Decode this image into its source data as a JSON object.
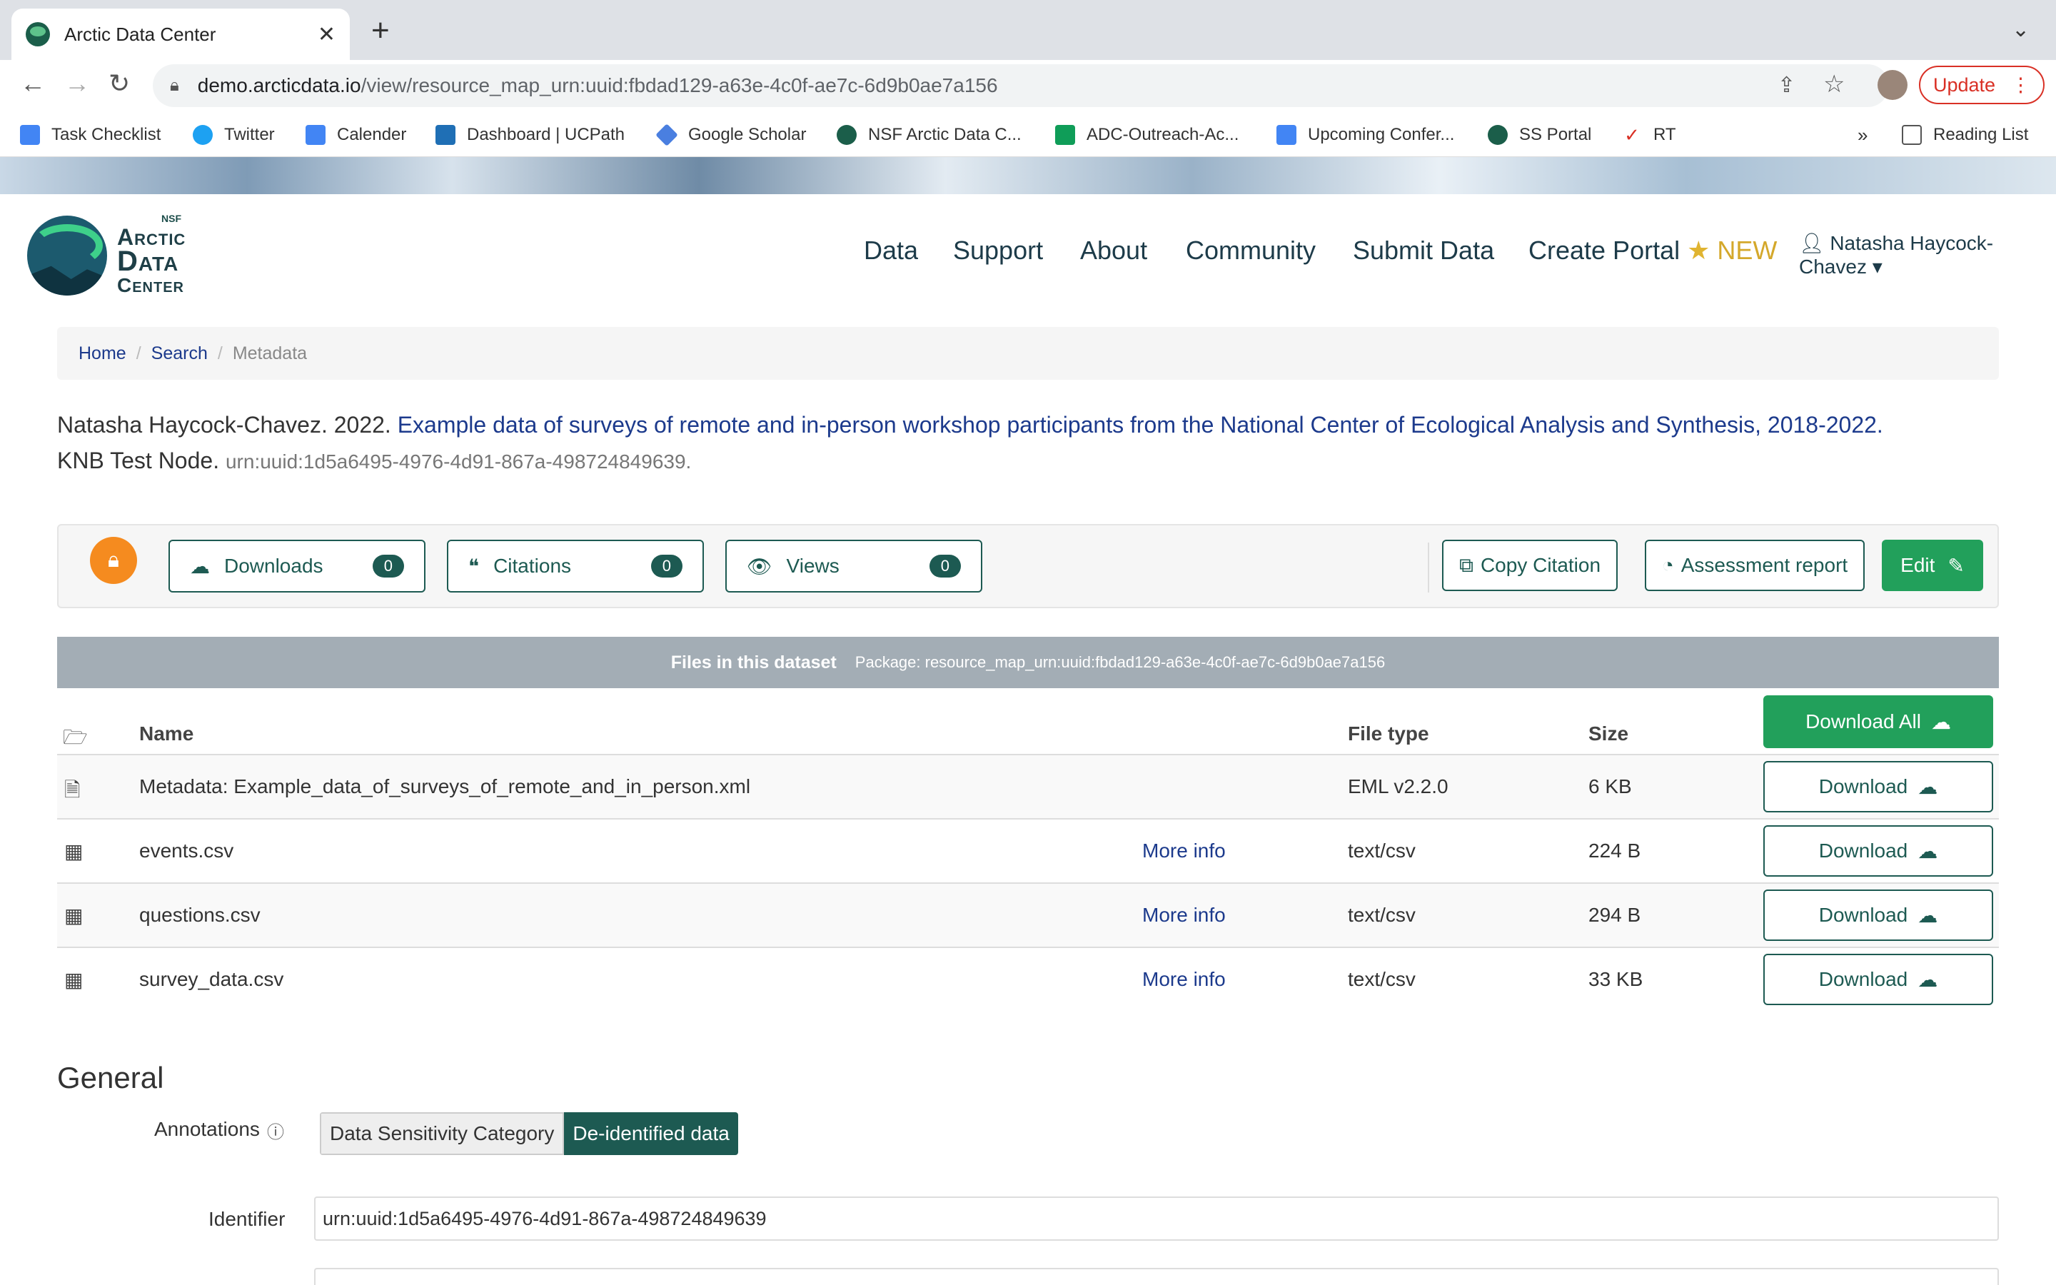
{
  "browser": {
    "tab_title": "Arctic Data Center",
    "url_host": "demo.arcticdata.io",
    "url_path": "/view/resource_map_urn:uuid:fbdad129-a63e-4c0f-ae7c-6d9b0ae7a156",
    "update_label": "Update",
    "bookmarks": [
      {
        "label": "Task Checklist",
        "color": "#4285f4"
      },
      {
        "label": "Twitter",
        "color": "#1da1f2"
      },
      {
        "label": "Calender",
        "color": "#4285f4"
      },
      {
        "label": "Dashboard | UCPath",
        "color": "#1f6fb5"
      },
      {
        "label": "Google Scholar",
        "color": "#4a7fe0"
      },
      {
        "label": "NSF Arctic Data C...",
        "color": "#1b5e4a"
      },
      {
        "label": "ADC-Outreach-Ac...",
        "color": "#0f9d58"
      },
      {
        "label": "Upcoming Confer...",
        "color": "#4285f4"
      },
      {
        "label": "SS Portal",
        "color": "#1b5e4a"
      },
      {
        "label": "RT",
        "color": "#d93025"
      }
    ],
    "overflow_label": "»",
    "reading_list": "Reading List"
  },
  "site": {
    "logo": {
      "nsf": "NSF",
      "line1": "Arctic",
      "line2": "Data",
      "line3": "Center"
    },
    "nav": [
      "Data",
      "Support",
      "About",
      "Community",
      "Submit Data",
      "Create Portal"
    ],
    "nav_new": "NEW",
    "user": "Natasha Haycock-Chavez"
  },
  "breadcrumb": {
    "home": "Home",
    "search": "Search",
    "current": "Metadata"
  },
  "citation": {
    "authors": "Natasha Haycock-Chavez. 2022. ",
    "title": "Example data of surveys of remote and in-person workshop participants from the National Center of Ecological Analysis and Synthesis, 2018-2022.",
    "repo": "KNB Test Node. ",
    "id": "urn:uuid:1d5a6495-4976-4d91-867a-498724849639."
  },
  "metrics": {
    "downloads": {
      "label": "Downloads",
      "count": "0"
    },
    "citations": {
      "label": "Citations",
      "count": "0"
    },
    "views": {
      "label": "Views",
      "count": "0"
    },
    "copy_citation": "Copy Citation",
    "assessment": "Assessment report",
    "edit": "Edit"
  },
  "files": {
    "header_title": "Files in this dataset",
    "package": "Package: resource_map_urn:uuid:fbdad129-a63e-4c0f-ae7c-6d9b0ae7a156",
    "columns": {
      "name": "Name",
      "type": "File type",
      "size": "Size"
    },
    "download_all": "Download All",
    "rows": [
      {
        "name": "Metadata: Example_data_of_surveys_of_remote_and_in_person.xml",
        "more": "",
        "type": "EML v2.2.0",
        "size": "6 KB",
        "download": "Download"
      },
      {
        "name": "events.csv",
        "more": "More info",
        "type": "text/csv",
        "size": "224 B",
        "download": "Download"
      },
      {
        "name": "questions.csv",
        "more": "More info",
        "type": "text/csv",
        "size": "294 B",
        "download": "Download"
      },
      {
        "name": "survey_data.csv",
        "more": "More info",
        "type": "text/csv",
        "size": "33 KB",
        "download": "Download"
      }
    ]
  },
  "general": {
    "heading": "General",
    "annotations_label": "Annotations",
    "annotation_key": "Data Sensitivity Category",
    "annotation_value": "De-identified data",
    "identifier_label": "Identifier",
    "identifier_value": "urn:uuid:1d5a6495-4976-4d91-867a-498724849639"
  }
}
